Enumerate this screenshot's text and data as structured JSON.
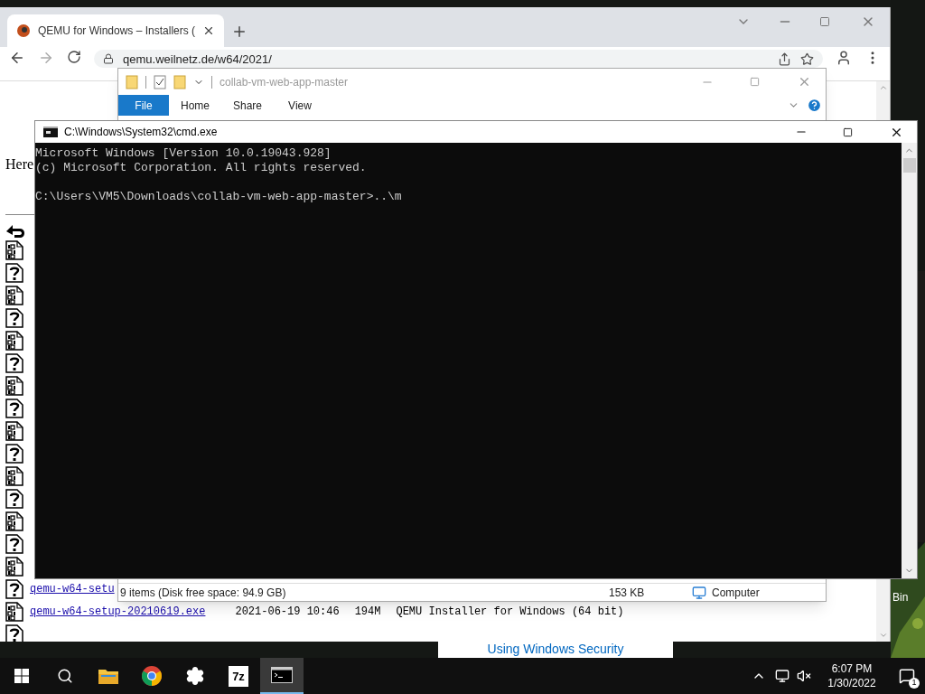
{
  "browser": {
    "tab_title": "QEMU for Windows – Installers (",
    "url": "qemu.weilnetz.de/w64/2021/",
    "page": {
      "intro": "Here",
      "rows": [
        {
          "kind": "binary"
        },
        {
          "kind": "unknown"
        },
        {
          "kind": "binary"
        },
        {
          "kind": "unknown"
        },
        {
          "kind": "binary"
        },
        {
          "kind": "unknown"
        },
        {
          "kind": "binary"
        },
        {
          "kind": "unknown"
        },
        {
          "kind": "binary"
        },
        {
          "kind": "unknown"
        },
        {
          "kind": "binary"
        },
        {
          "kind": "unknown"
        },
        {
          "kind": "binary"
        },
        {
          "kind": "unknown"
        },
        {
          "kind": "binary"
        },
        {
          "kind": "unknown",
          "link": "qemu-w64-setu"
        },
        {
          "kind": "binary",
          "link": "qemu-w64-setup-20210619.exe",
          "date": "2021-06-19 10:46",
          "size": "194M",
          "description": "QEMU Installer for Windows (64 bit)"
        },
        {
          "kind": "unknown"
        }
      ]
    }
  },
  "explorer": {
    "title": "collab-vm-web-app-master",
    "ribbon_tabs": [
      {
        "label": "File",
        "selected": true
      },
      {
        "label": "Home",
        "selected": false
      },
      {
        "label": "Share",
        "selected": false
      },
      {
        "label": "View",
        "selected": false
      }
    ],
    "status": {
      "items": "9 items (Disk free space: 94.9 GB)",
      "size": "153 KB",
      "location": "Computer"
    }
  },
  "console": {
    "title": "C:\\Windows\\System32\\cmd.exe",
    "banner_lines": [
      "Microsoft Windows [Version 10.0.19043.928]",
      "(c) Microsoft Corporation. All rights reserved."
    ],
    "prompt": "C:\\Users\\VM5\\Downloads\\collab-vm-web-app-master>..\\m"
  },
  "notification": {
    "text": "Using Windows Security"
  },
  "desktop": {
    "icon_label": "Bin"
  },
  "taskbar": {
    "apps": [
      {
        "kind": "explorer",
        "selected": false
      },
      {
        "kind": "chrome",
        "selected": false
      },
      {
        "kind": "settings",
        "selected": false
      },
      {
        "kind": "archiver",
        "label": "7z",
        "selected": false
      },
      {
        "kind": "terminal",
        "selected": true
      }
    ],
    "time": "6:07 PM",
    "date": "1/30/2022",
    "notification_count": "1"
  }
}
